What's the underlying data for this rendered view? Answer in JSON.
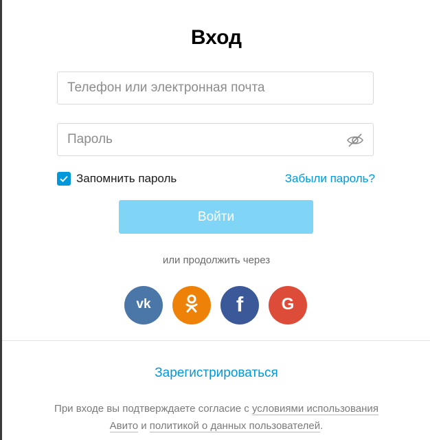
{
  "form": {
    "title": "Вход",
    "login_placeholder": "Телефон или электронная почта",
    "password_placeholder": "Пароль",
    "remember_label": "Запомнить пароль",
    "remember_checked": true,
    "forgot_label": "Забыли пароль?",
    "submit_label": "Войти",
    "continue_text": "или продолжить через"
  },
  "social": {
    "vk": {
      "label": "vk",
      "icon": "vk-icon",
      "color": "#4a76a8"
    },
    "ok": {
      "icon": "odnoklassniki-icon",
      "color": "#ee8208"
    },
    "facebook": {
      "label": "f",
      "icon": "facebook-icon",
      "color": "#3b5998"
    },
    "google": {
      "label": "G",
      "icon": "google-icon",
      "color": "#dd4b39"
    }
  },
  "footer": {
    "register_label": "Зарегистрироваться",
    "terms_prefix": "При входе вы подтверждаете согласие с ",
    "terms_link": "условиями использования Авито",
    "terms_middle": " и ",
    "privacy_link": "политикой о данных пользователей",
    "terms_suffix": "."
  },
  "colors": {
    "accent": "#0098db",
    "button_disabled": "#80d4f6"
  }
}
